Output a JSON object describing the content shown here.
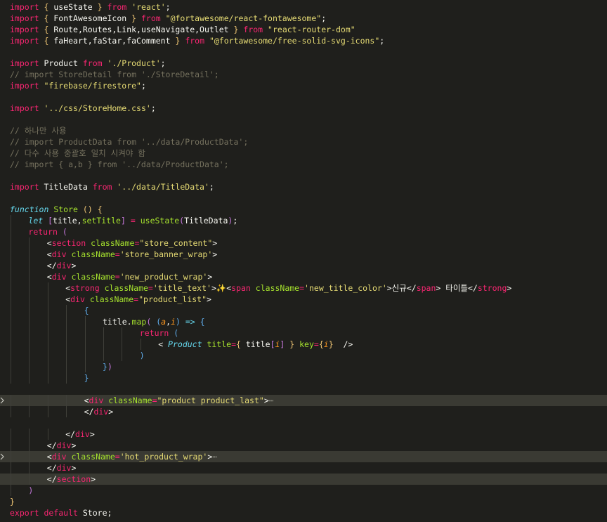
{
  "editor": {
    "theme_colors": {
      "background": "#1f1f1c",
      "keyword": "#f92672",
      "string": "#e6db74",
      "comment": "#75715e",
      "function": "#a6e22e",
      "storage": "#66d9ef",
      "parameter": "#fd971f",
      "highlight": "#3a3a33"
    },
    "lines": [
      {
        "indent": 0,
        "tokens": [
          [
            "kw",
            "import"
          ],
          [
            "p",
            " "
          ],
          [
            "by",
            "{"
          ],
          [
            "p",
            " useState "
          ],
          [
            "by",
            "}"
          ],
          [
            "p",
            " "
          ],
          [
            "kw",
            "from"
          ],
          [
            "p",
            " "
          ],
          [
            "str",
            "'react'"
          ],
          [
            "p",
            ";"
          ]
        ]
      },
      {
        "indent": 0,
        "tokens": [
          [
            "kw",
            "import"
          ],
          [
            "p",
            " "
          ],
          [
            "by",
            "{"
          ],
          [
            "p",
            " FontAwesomeIcon "
          ],
          [
            "by",
            "}"
          ],
          [
            "p",
            " "
          ],
          [
            "kw",
            "from"
          ],
          [
            "p",
            " "
          ],
          [
            "str",
            "\"@fortawesome/react-fontawesome\""
          ],
          [
            "p",
            ";"
          ]
        ]
      },
      {
        "indent": 0,
        "tokens": [
          [
            "kw",
            "import"
          ],
          [
            "p",
            " "
          ],
          [
            "by",
            "{"
          ],
          [
            "p",
            " Route,Routes,Link,useNavigate,Outlet "
          ],
          [
            "by",
            "}"
          ],
          [
            "p",
            " "
          ],
          [
            "kw",
            "from"
          ],
          [
            "p",
            " "
          ],
          [
            "str",
            "\"react-router-dom\""
          ]
        ]
      },
      {
        "indent": 0,
        "tokens": [
          [
            "kw",
            "import"
          ],
          [
            "p",
            " "
          ],
          [
            "by",
            "{"
          ],
          [
            "p",
            " faHeart,faStar,faComment "
          ],
          [
            "by",
            "}"
          ],
          [
            "p",
            " "
          ],
          [
            "kw",
            "from"
          ],
          [
            "p",
            " "
          ],
          [
            "str",
            "\"@fortawesome/free-solid-svg-icons\""
          ],
          [
            "p",
            ";"
          ]
        ]
      },
      {
        "indent": 0,
        "tokens": []
      },
      {
        "indent": 0,
        "tokens": [
          [
            "kw",
            "import"
          ],
          [
            "p",
            " Product "
          ],
          [
            "kw",
            "from"
          ],
          [
            "p",
            " "
          ],
          [
            "str",
            "'./Product'"
          ],
          [
            "p",
            ";"
          ]
        ]
      },
      {
        "indent": 0,
        "tokens": [
          [
            "cm",
            "// import StoreDetail from './StoreDetail';"
          ]
        ]
      },
      {
        "indent": 0,
        "tokens": [
          [
            "kw",
            "import"
          ],
          [
            "p",
            " "
          ],
          [
            "str",
            "\"firebase/firestore\""
          ],
          [
            "p",
            ";"
          ]
        ]
      },
      {
        "indent": 0,
        "tokens": []
      },
      {
        "indent": 0,
        "tokens": [
          [
            "kw",
            "import"
          ],
          [
            "p",
            " "
          ],
          [
            "str",
            "'../css/StoreHome.css'"
          ],
          [
            "p",
            ";"
          ]
        ]
      },
      {
        "indent": 0,
        "tokens": []
      },
      {
        "indent": 0,
        "tokens": [
          [
            "cm",
            "// 하나만 사용"
          ]
        ]
      },
      {
        "indent": 0,
        "tokens": [
          [
            "cm",
            "// import ProductData from '../data/ProductData';"
          ]
        ]
      },
      {
        "indent": 0,
        "tokens": [
          [
            "cm",
            "// 다수 사용 중괄호 일치 시켜야 함"
          ]
        ]
      },
      {
        "indent": 0,
        "tokens": [
          [
            "cm",
            "// import { a,b } from '../data/ProductData';"
          ]
        ]
      },
      {
        "indent": 0,
        "tokens": []
      },
      {
        "indent": 0,
        "tokens": [
          [
            "kw",
            "import"
          ],
          [
            "p",
            " TitleData "
          ],
          [
            "kw",
            "from"
          ],
          [
            "p",
            " "
          ],
          [
            "str",
            "'../data/TitleData'"
          ],
          [
            "p",
            ";"
          ]
        ]
      },
      {
        "indent": 0,
        "tokens": []
      },
      {
        "indent": 0,
        "tokens": [
          [
            "st",
            "function"
          ],
          [
            "p",
            " "
          ],
          [
            "fn",
            "Store"
          ],
          [
            "p",
            " "
          ],
          [
            "by",
            "()"
          ],
          [
            "p",
            " "
          ],
          [
            "by",
            "{"
          ]
        ]
      },
      {
        "indent": 1,
        "tokens": [
          [
            "st",
            "let"
          ],
          [
            "p",
            " "
          ],
          [
            "bp",
            "["
          ],
          [
            "p",
            "title,"
          ],
          [
            "fn",
            "setTitle"
          ],
          [
            "bp",
            "]"
          ],
          [
            "p",
            " "
          ],
          [
            "kw",
            "="
          ],
          [
            "p",
            " "
          ],
          [
            "fn",
            "useState"
          ],
          [
            "bp",
            "("
          ],
          [
            "p",
            "TitleData"
          ],
          [
            "bp",
            ")"
          ],
          [
            "p",
            ";"
          ]
        ]
      },
      {
        "indent": 1,
        "tokens": [
          [
            "kw",
            "return"
          ],
          [
            "p",
            " "
          ],
          [
            "bp",
            "("
          ]
        ]
      },
      {
        "indent": 2,
        "tokens": [
          [
            "p",
            "<"
          ],
          [
            "tag",
            "section"
          ],
          [
            "p",
            " "
          ],
          [
            "attr",
            "className"
          ],
          [
            "kw",
            "="
          ],
          [
            "str",
            "\"store_content\""
          ],
          [
            "p",
            ">"
          ]
        ]
      },
      {
        "indent": 2,
        "tokens": [
          [
            "p",
            "<"
          ],
          [
            "tag",
            "div"
          ],
          [
            "p",
            " "
          ],
          [
            "attr",
            "className"
          ],
          [
            "kw",
            "="
          ],
          [
            "str",
            "'store_banner_wrap'"
          ],
          [
            "p",
            ">"
          ]
        ]
      },
      {
        "indent": 2,
        "tokens": [
          [
            "p",
            "</"
          ],
          [
            "tag",
            "div"
          ],
          [
            "p",
            ">"
          ]
        ]
      },
      {
        "indent": 2,
        "tokens": [
          [
            "p",
            "<"
          ],
          [
            "tag",
            "div"
          ],
          [
            "p",
            " "
          ],
          [
            "attr",
            "className"
          ],
          [
            "kw",
            "="
          ],
          [
            "str",
            "'new_product_wrap'"
          ],
          [
            "p",
            ">"
          ]
        ]
      },
      {
        "indent": 3,
        "tokens": [
          [
            "p",
            "<"
          ],
          [
            "tag",
            "strong"
          ],
          [
            "p",
            " "
          ],
          [
            "attr",
            "className"
          ],
          [
            "kw",
            "="
          ],
          [
            "str",
            "'title_text'"
          ],
          [
            "p",
            ">"
          ],
          [
            "star",
            "✨"
          ],
          [
            "p",
            "<"
          ],
          [
            "tag",
            "span"
          ],
          [
            "p",
            " "
          ],
          [
            "attr",
            "className"
          ],
          [
            "kw",
            "="
          ],
          [
            "str",
            "'new_title_color'"
          ],
          [
            "p",
            ">신규</"
          ],
          [
            "tag",
            "span"
          ],
          [
            "p",
            "> 타이틀</"
          ],
          [
            "tag",
            "strong"
          ],
          [
            "p",
            ">"
          ]
        ]
      },
      {
        "indent": 3,
        "tokens": [
          [
            "p",
            "<"
          ],
          [
            "tag",
            "div"
          ],
          [
            "p",
            " "
          ],
          [
            "attr",
            "className"
          ],
          [
            "kw",
            "="
          ],
          [
            "str",
            "\"product_list\""
          ],
          [
            "p",
            ">"
          ]
        ]
      },
      {
        "indent": 4,
        "tokens": [
          [
            "bb",
            "{"
          ]
        ]
      },
      {
        "indent": 5,
        "tokens": [
          [
            "p",
            "title."
          ],
          [
            "fn",
            "map"
          ],
          [
            "bp",
            "("
          ],
          [
            "p",
            " "
          ],
          [
            "bb",
            "("
          ],
          [
            "par",
            "a"
          ],
          [
            "p",
            ","
          ],
          [
            "par",
            "i"
          ],
          [
            "bb",
            ")"
          ],
          [
            "p",
            " "
          ],
          [
            "st",
            "=>"
          ],
          [
            "p",
            " "
          ],
          [
            "bb",
            "{"
          ]
        ]
      },
      {
        "indent": 7,
        "tokens": [
          [
            "kw",
            "return"
          ],
          [
            "p",
            " "
          ],
          [
            "bb",
            "("
          ]
        ]
      },
      {
        "indent": 8,
        "tokens": [
          [
            "p",
            "< "
          ],
          [
            "st",
            "Product"
          ],
          [
            "p",
            " "
          ],
          [
            "attr",
            "title"
          ],
          [
            "kw",
            "="
          ],
          [
            "by",
            "{"
          ],
          [
            "p",
            " title"
          ],
          [
            "bp",
            "["
          ],
          [
            "par",
            "i"
          ],
          [
            "bp",
            "]"
          ],
          [
            "p",
            " "
          ],
          [
            "by",
            "}"
          ],
          [
            "p",
            " "
          ],
          [
            "attr",
            "key"
          ],
          [
            "kw",
            "="
          ],
          [
            "by",
            "{"
          ],
          [
            "par",
            "i"
          ],
          [
            "by",
            "}"
          ],
          [
            "p",
            "  />"
          ]
        ]
      },
      {
        "indent": 7,
        "tokens": [
          [
            "bb",
            ")"
          ]
        ]
      },
      {
        "indent": 5,
        "tokens": [
          [
            "bb",
            "}"
          ],
          [
            "bp",
            ")"
          ]
        ]
      },
      {
        "indent": 4,
        "tokens": [
          [
            "bb",
            "}"
          ]
        ]
      },
      {
        "indent": 0,
        "tokens": []
      },
      {
        "indent": 4,
        "highlight": true,
        "fold": true,
        "tokens": [
          [
            "p",
            "<"
          ],
          [
            "tag",
            "div"
          ],
          [
            "p",
            " "
          ],
          [
            "attr",
            "className"
          ],
          [
            "kw",
            "="
          ],
          [
            "str",
            "\"product product_last\""
          ],
          [
            "p",
            ">"
          ],
          [
            "el",
            "⋯"
          ]
        ]
      },
      {
        "indent": 4,
        "tokens": [
          [
            "p",
            "</"
          ],
          [
            "tag",
            "div"
          ],
          [
            "p",
            ">"
          ]
        ]
      },
      {
        "indent": 0,
        "tokens": []
      },
      {
        "indent": 3,
        "tokens": [
          [
            "p",
            "</"
          ],
          [
            "tag",
            "div"
          ],
          [
            "p",
            ">"
          ]
        ]
      },
      {
        "indent": 2,
        "tokens": [
          [
            "p",
            "</"
          ],
          [
            "tag",
            "div"
          ],
          [
            "p",
            ">"
          ]
        ]
      },
      {
        "indent": 2,
        "highlight": true,
        "fold": true,
        "tokens": [
          [
            "p",
            "<"
          ],
          [
            "tag",
            "div"
          ],
          [
            "p",
            " "
          ],
          [
            "attr",
            "className"
          ],
          [
            "kw",
            "="
          ],
          [
            "str",
            "'hot_product_wrap'"
          ],
          [
            "p",
            ">"
          ],
          [
            "el",
            "⋯"
          ]
        ]
      },
      {
        "indent": 2,
        "tokens": [
          [
            "p",
            "</"
          ],
          [
            "tag",
            "div"
          ],
          [
            "p",
            ">"
          ]
        ]
      },
      {
        "indent": 2,
        "highlight": true,
        "tokens": [
          [
            "p",
            "</"
          ],
          [
            "tag",
            "section"
          ],
          [
            "p",
            ">"
          ]
        ]
      },
      {
        "indent": 1,
        "tokens": [
          [
            "bp",
            ")"
          ]
        ]
      },
      {
        "indent": 0,
        "tokens": [
          [
            "by",
            "}"
          ]
        ]
      },
      {
        "indent": 0,
        "tokens": [
          [
            "kw",
            "export"
          ],
          [
            "p",
            " "
          ],
          [
            "kw",
            "default"
          ],
          [
            "p",
            " Store;"
          ]
        ]
      }
    ]
  }
}
